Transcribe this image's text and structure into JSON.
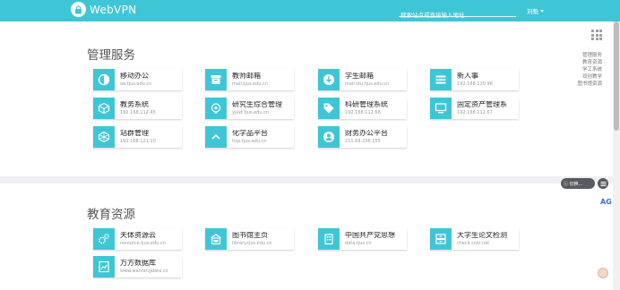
{
  "header": {
    "logo_text": "WebVPN",
    "search_placeholder": "搜索站点或直接输入地址",
    "user_label": "刘魁"
  },
  "sections": [
    {
      "title": "管理服务",
      "cards": [
        {
          "title": "移动办公",
          "sub": "oa.tjus.edu.cn",
          "icon": "half-circle-icon"
        },
        {
          "title": "教师邮箱",
          "sub": "mail.tjus.edu.cn",
          "icon": "archive-box-icon"
        },
        {
          "title": "学生邮箱",
          "sub": "mail.stu.tjus.edu.cn",
          "icon": "download-circle-icon"
        },
        {
          "title": "新人事",
          "sub": "192.168.120.98",
          "icon": "list-icon"
        },
        {
          "title": "教务系统",
          "sub": "192.168.112.45",
          "icon": "cube-icon"
        },
        {
          "title": "研究生综合管理",
          "sub": "yjsxt.tjus.edu.cn",
          "icon": "lightbulb-gear-icon"
        },
        {
          "title": "科研管理系统",
          "sub": "192.168.112.66",
          "icon": "tag-icon"
        },
        {
          "title": "固定资产管理系",
          "sub": "192.168.112.67",
          "icon": "monitor-icon"
        },
        {
          "title": "站群管理",
          "sub": "192.168.121.10",
          "icon": "network-cube-icon"
        },
        {
          "title": "化学品平台",
          "sub": "hxp.tjus.edu.cn",
          "icon": "chevron-up-icon"
        },
        {
          "title": "财务办公平台",
          "sub": "211.68.236.155",
          "icon": "user-circle-icon"
        }
      ]
    },
    {
      "title": "教育资源",
      "cards": [
        {
          "title": "天体资源云",
          "sub": "resource.tjus.edu.cn",
          "icon": "gears-icon"
        },
        {
          "title": "图书馆主页",
          "sub": "library.tjus.edu.cn",
          "icon": "library-icon"
        },
        {
          "title": "中国共产党思想",
          "sub": "data.tjus.cn",
          "icon": "building-icon"
        },
        {
          "title": "大学生论文检测",
          "sub": "check.cnki.net",
          "icon": "cabinet-icon"
        },
        {
          "title": "万方数据库",
          "sub": "www.wanfangdata.co",
          "icon": "chart-doc-icon"
        }
      ]
    }
  ],
  "side_nav": [
    "管理服务",
    "教育资源",
    "学工系统",
    "双创教学",
    "图书馆资源"
  ],
  "floating": {
    "pill_label": "ⓘ 切换...",
    "ag_label": "AG"
  },
  "colors": {
    "accent": "#3fc6d6",
    "page_bg": "#eeeff2"
  }
}
